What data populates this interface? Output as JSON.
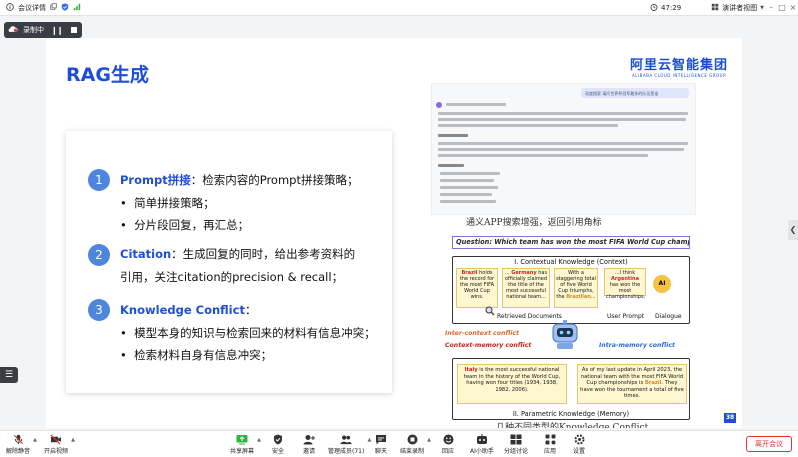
{
  "topbar": {
    "meeting_details": "会议详情",
    "timer": "47:29",
    "speaker_view": "演讲者视图"
  },
  "recording": {
    "label": "录制中"
  },
  "slide": {
    "title": "RAG生成",
    "logo_cn": "阿里云智能集团",
    "logo_en": "ALIBABA CLOUD INTELLIGENCE GROUP",
    "sections": [
      {
        "num": "1",
        "keyword": "Prompt拼接",
        "text": "：检索内容的Prompt拼接策略；",
        "bullets": [
          "简单拼接策略；",
          "分片段回复，再汇总；"
        ]
      },
      {
        "num": "2",
        "keyword": "Citation",
        "text": "：生成回复的同时，给出参考资料的引用，关注citation的precision & recall；",
        "bullets": []
      },
      {
        "num": "3",
        "keyword": "Knowledge Conflict",
        "text": "：",
        "bullets": [
          "模型本身的知识与检索回来的材料有信息冲突；",
          "检索材料自身有信息冲突；"
        ]
      }
    ],
    "screenshot_bubble": "深度搜索  请问世界杯冠军最多的队伍是谁",
    "caption1": "通义APP搜索增强，返回引用角标",
    "figure": {
      "question": "Question: Which team has won the most FIFA World Cup championships?",
      "context_title": "I. Contextual Knowledge (Context)",
      "notes": {
        "brazil_a": "Brazil",
        "brazil_b": " holds the record for the most FIFA World Cup wins.",
        "germany_a": "... ",
        "germany_b": "Germany",
        "germany_c": " has officially claimed the title of the most successful national team...",
        "staggering_a": "With a staggering total of five World Cup triumphs, the ",
        "staggering_b": "Brazilian",
        "staggering_c": "...",
        "argentina_a": "...I think ",
        "argentina_b": "Argentina",
        "argentina_c": " has won the most championships."
      },
      "retrieved": "Retrieved Documents",
      "user_prompt": "User Prompt",
      "dialogue": "Dialogue",
      "ai_label": "AI",
      "inter_conflict": "Inter-context conflict",
      "ctx_mem_conflict": "Context-memory conflict",
      "intra_conflict": "Intra-memory conflict",
      "param_left_a": "Italy",
      "param_left_b": " is the most successful national team in the history of the World Cup, having won four titles (1934, 1938, 1982, 2006).",
      "param_right_a": "As of my last update in April 2023, the national team with the most FIFA World Cup championships is ",
      "param_right_b": "Brazil",
      "param_right_c": ". They have won the tournament a total of five times.",
      "param_title": "II. Parametric Knowledge (Memory)"
    },
    "caption2": "几种不同类型的Knowledge Conflict",
    "page_number": "38"
  },
  "toolbar": {
    "items": [
      {
        "label": "解除静音",
        "icon": "mic-muted-icon"
      },
      {
        "label": "开启视频",
        "icon": "camera-off-icon"
      },
      {
        "label": "共享屏幕",
        "icon": "share-screen-icon"
      },
      {
        "label": "安全",
        "icon": "shield-icon"
      },
      {
        "label": "邀请",
        "icon": "invite-icon"
      },
      {
        "label": "管理成员(71)",
        "icon": "members-icon"
      },
      {
        "label": "聊天",
        "icon": "chat-icon"
      },
      {
        "label": "结束录制",
        "icon": "stop-record-icon"
      },
      {
        "label": "回应",
        "icon": "reaction-icon"
      },
      {
        "label": "AI小助手",
        "icon": "ai-assistant-icon"
      },
      {
        "label": "分组讨论",
        "icon": "breakout-icon"
      },
      {
        "label": "应用",
        "icon": "apps-icon"
      },
      {
        "label": "设置",
        "icon": "settings-icon"
      }
    ],
    "leave": "离开会议"
  },
  "colors": {
    "accent": "#1e4dd8",
    "leave": "#e0392f",
    "number_circle": "#4f86dd"
  }
}
